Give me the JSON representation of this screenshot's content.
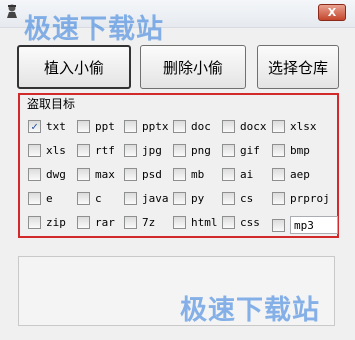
{
  "window": {
    "close_label": "X"
  },
  "watermark": {
    "text_top": "极速下载站",
    "text_bottom": "极速下载站"
  },
  "buttons": {
    "plant": "植入小偷",
    "delete": "删除小偷",
    "choose_repo": "选择仓库"
  },
  "target_group": {
    "title": "盗取目标",
    "extensions": [
      {
        "label": "txt",
        "checked": true
      },
      {
        "label": "ppt",
        "checked": false
      },
      {
        "label": "pptx",
        "checked": false
      },
      {
        "label": "doc",
        "checked": false
      },
      {
        "label": "docx",
        "checked": false
      },
      {
        "label": "xlsx",
        "checked": false
      },
      {
        "label": "xls",
        "checked": false
      },
      {
        "label": "rtf",
        "checked": false
      },
      {
        "label": "jpg",
        "checked": false
      },
      {
        "label": "png",
        "checked": false
      },
      {
        "label": "gif",
        "checked": false
      },
      {
        "label": "bmp",
        "checked": false
      },
      {
        "label": "dwg",
        "checked": false
      },
      {
        "label": "max",
        "checked": false
      },
      {
        "label": "psd",
        "checked": false
      },
      {
        "label": "mb",
        "checked": false
      },
      {
        "label": "ai",
        "checked": false
      },
      {
        "label": "aep",
        "checked": false
      },
      {
        "label": "e",
        "checked": false
      },
      {
        "label": "c",
        "checked": false
      },
      {
        "label": "java",
        "checked": false
      },
      {
        "label": "py",
        "checked": false
      },
      {
        "label": "cs",
        "checked": false
      },
      {
        "label": "prproj",
        "checked": false
      },
      {
        "label": "zip",
        "checked": false
      },
      {
        "label": "rar",
        "checked": false
      },
      {
        "label": "7z",
        "checked": false
      },
      {
        "label": "html",
        "checked": false
      },
      {
        "label": "css",
        "checked": false
      }
    ],
    "custom_ext_value": "mp3"
  },
  "colors": {
    "group_border": "#d22a2a",
    "watermark": "#2878dc"
  }
}
